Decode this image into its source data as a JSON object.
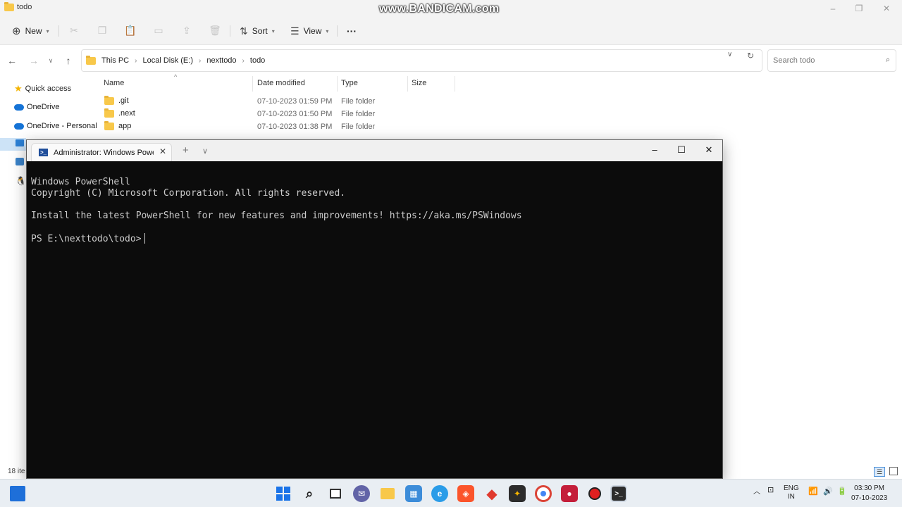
{
  "explorer": {
    "window_title": "todo",
    "watermark": "www.BANDICAM.com",
    "toolbar": {
      "new_label": "New",
      "sort_label": "Sort",
      "view_label": "View",
      "more_label": "···"
    },
    "breadcrumb": [
      "This PC",
      "Local Disk (E:)",
      "nexttodo",
      "todo"
    ],
    "search_placeholder": "Search todo",
    "sidebar": [
      {
        "label": "Quick access",
        "icon": "star-icon"
      },
      {
        "label": "OneDrive",
        "icon": "cloud-icon"
      },
      {
        "label": "OneDrive - Personal",
        "icon": "cloud-icon"
      }
    ],
    "columns": {
      "name": "Name",
      "date": "Date modified",
      "type": "Type",
      "size": "Size"
    },
    "files": [
      {
        "name": ".git",
        "date": "07-10-2023 01:59 PM",
        "type": "File folder"
      },
      {
        "name": ".next",
        "date": "07-10-2023 01:50 PM",
        "type": "File folder"
      },
      {
        "name": "app",
        "date": "07-10-2023 01:38 PM",
        "type": "File folder"
      }
    ],
    "status": "18 ite"
  },
  "terminal": {
    "tab_title": "Administrator: Windows PowerS",
    "lines": [
      "Windows PowerShell",
      "Copyright (C) Microsoft Corporation. All rights reserved.",
      "",
      "Install the latest PowerShell for new features and improvements! https://aka.ms/PSWindows",
      ""
    ],
    "prompt": "PS E:\\nexttodo\\todo>"
  },
  "taskbar": {
    "language_line1": "ENG",
    "language_line2": "IN",
    "time": "03:30 PM",
    "date": "07-10-2023"
  },
  "colors": {
    "terminal_bg": "#0c0c0c",
    "folder": "#f8c84a",
    "accent": "#0067c0"
  }
}
